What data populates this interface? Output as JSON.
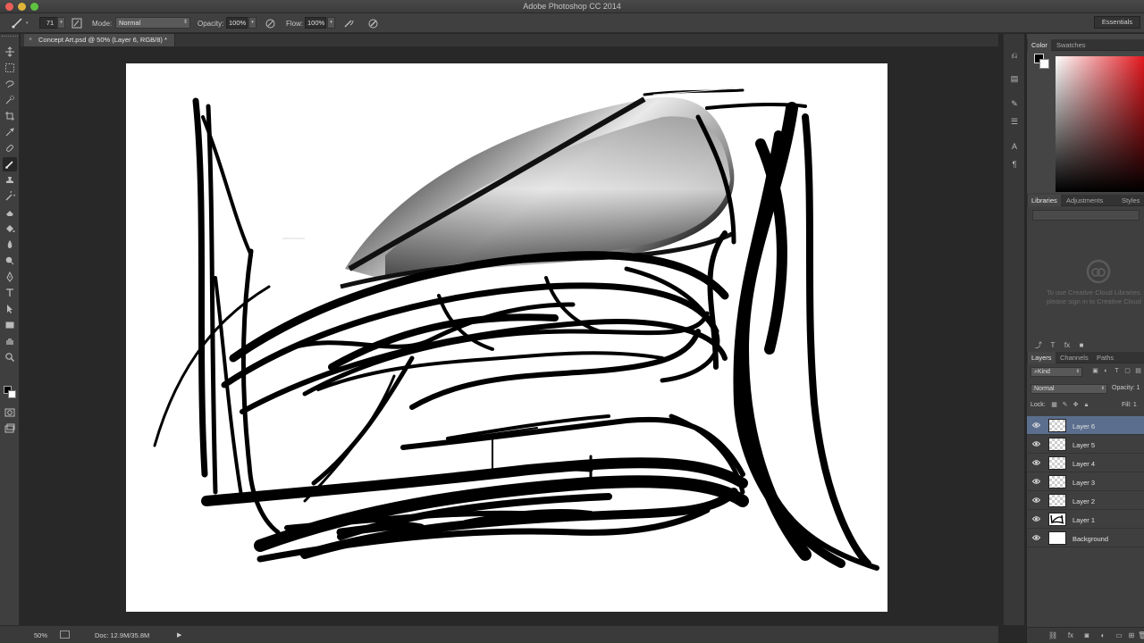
{
  "window": {
    "title": "Adobe Photoshop CC 2014"
  },
  "options_bar": {
    "brush_size": "71",
    "mode_label": "Mode:",
    "mode_value": "Normal",
    "opacity_label": "Opacity:",
    "opacity_value": "100%",
    "flow_label": "Flow:",
    "flow_value": "100%",
    "workspace": "Essentials"
  },
  "document": {
    "tab_label": "Concept Art.psd @ 50% (Layer 6, RGB/8) *",
    "close_symbol": "×"
  },
  "status_bar": {
    "zoom": "50%",
    "doc_size": "Doc: 12.9M/35.8M",
    "play_symbol": "▶"
  },
  "color_panel": {
    "tabs": [
      "Color",
      "Swatches"
    ],
    "fg_color": "#000000",
    "bg_color": "#ffffff",
    "hue_color": "#e3161d"
  },
  "libraries_panel": {
    "tabs": [
      "Libraries",
      "Adjustments",
      "Styles"
    ],
    "message_line1": "To use Creative Cloud Libraries",
    "message_line2": "please sign in to Creative Cloud"
  },
  "layers_panel": {
    "tabs": [
      "Layers",
      "Channels",
      "Paths"
    ],
    "filter_kind": "Kind",
    "blend_mode": "Normal",
    "opacity_label": "Opacity:",
    "opacity_value": "1",
    "lock_label": "Lock:",
    "fill_label": "Fill:",
    "fill_value": "1",
    "layers": [
      {
        "name": "Layer 6",
        "selected": true,
        "thumb": "transparent"
      },
      {
        "name": "Layer 5",
        "selected": false,
        "thumb": "transparent"
      },
      {
        "name": "Layer 4",
        "selected": false,
        "thumb": "transparent"
      },
      {
        "name": "Layer 3",
        "selected": false,
        "thumb": "transparent"
      },
      {
        "name": "Layer 2",
        "selected": false,
        "thumb": "transparent"
      },
      {
        "name": "Layer 1",
        "selected": false,
        "thumb": "sketch"
      },
      {
        "name": "Background",
        "selected": false,
        "thumb": "white"
      }
    ]
  },
  "tools": [
    "move-tool-icon",
    "marquee-tool-icon",
    "lasso-tool-icon",
    "quick-selection-tool-icon",
    "crop-tool-icon",
    "eyedropper-tool-icon",
    "healing-brush-tool-icon",
    "brush-tool-icon",
    "clone-stamp-tool-icon",
    "history-brush-tool-icon",
    "eraser-tool-icon",
    "paint-bucket-tool-icon",
    "blur-tool-icon",
    "dodge-tool-icon",
    "pen-tool-icon",
    "type-tool-icon",
    "path-selection-tool-icon",
    "rectangle-tool-icon",
    "hand-tool-icon",
    "zoom-tool-icon"
  ]
}
